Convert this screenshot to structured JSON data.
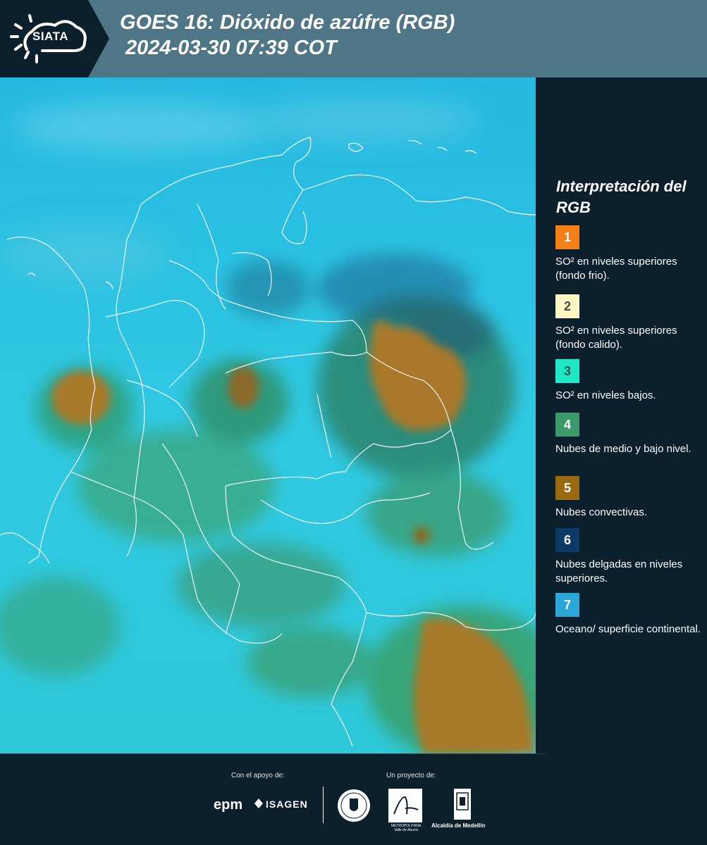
{
  "header": {
    "logo_text": "SIATA",
    "title_line1": "GOES 16: Dióxido de azúfre (RGB)",
    "title_line2": "2024-03-30 07:39 COT"
  },
  "legend": {
    "title": "Interpretación del RGB",
    "items": [
      {
        "number": "1",
        "label": "SO² en niveles superiores (fondo frio).",
        "color": "#f57f17",
        "text_color": "#ffffff"
      },
      {
        "number": "2",
        "label": "SO² en niveles superiores (fondo calido).",
        "color": "#fff8c4",
        "text_color": "#4a4a4a"
      },
      {
        "number": "3",
        "label": "SO² en niveles bajos.",
        "color": "#1de9c4",
        "text_color": "#2a5a52"
      },
      {
        "number": "4",
        "label": "Nubes de medio y bajo nivel.",
        "color": "#3a9a6a",
        "text_color": "#ffffff"
      },
      {
        "number": "5",
        "label": "Nubes convectivas.",
        "color": "#9a6a10",
        "text_color": "#ffffff"
      },
      {
        "number": "6",
        "label": "Nubes delgadas en niveles superiores.",
        "color": "#0b3a66",
        "text_color": "#ffffff"
      },
      {
        "number": "7",
        "label": "Oceano/ superficie continental.",
        "color": "#2aa7d8",
        "text_color": "#ffffff"
      }
    ]
  },
  "footer": {
    "support_label": "Con el apoyo de:",
    "project_label": "Un proyecto de:",
    "sponsor1": "epm",
    "sponsor2": "ISAGEN",
    "partner_area": "METROPOLITANA Valle de Aburrá",
    "partner_alcaldia": "Alcaldía de Medellín"
  },
  "colors": {
    "header_bg": "#4f7687",
    "page_bg": "#0c1f2c",
    "ocean": "#2cc6e6",
    "convective": "#a97a22"
  }
}
